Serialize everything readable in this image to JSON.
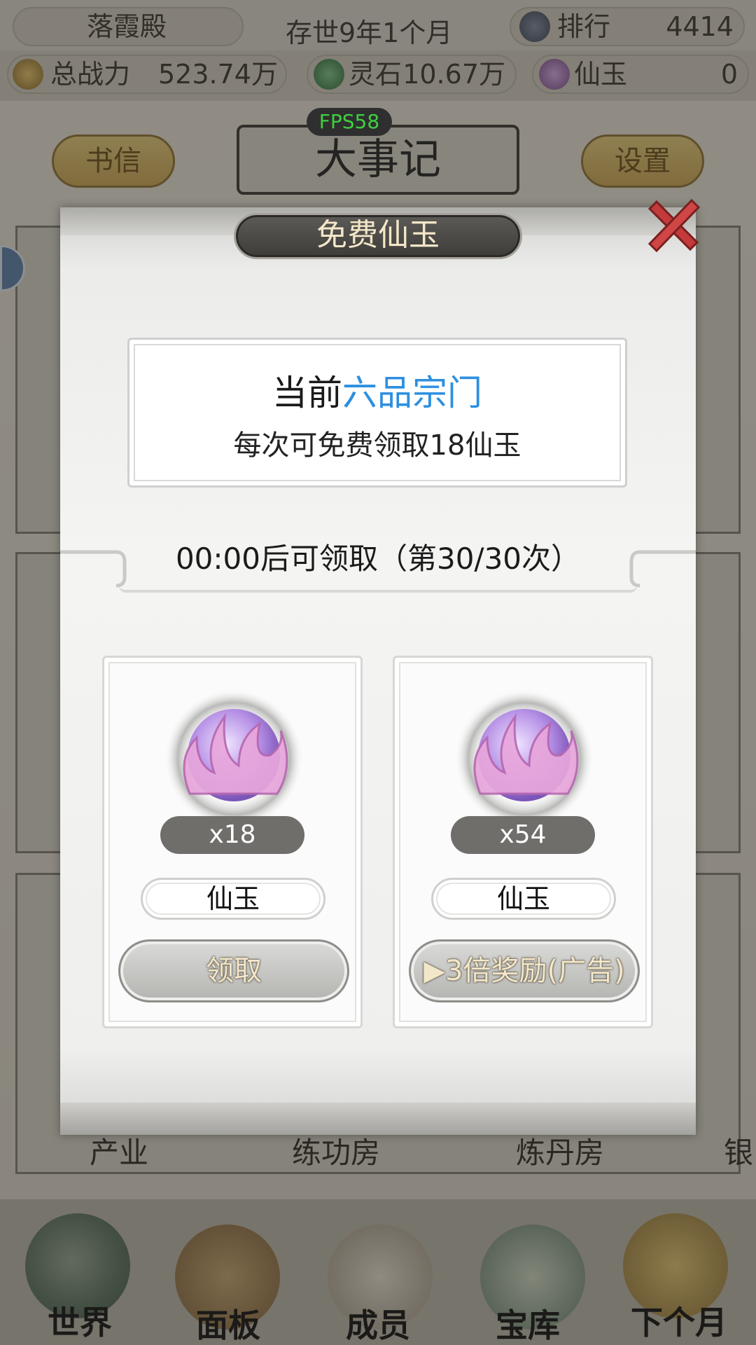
{
  "header": {
    "location": "落霞殿",
    "date": "存世9年1个月",
    "rank_label": "排行",
    "rank_value": "4414",
    "power_label": "总战力",
    "power_value": "523.74万",
    "spirit_stone_label": "灵石",
    "spirit_stone_value": "10.67万",
    "jade_label": "仙玉",
    "jade_value": "0"
  },
  "fps": "FPS58",
  "top_buttons": {
    "letters": "书信",
    "chronicle": "大事记",
    "settings": "设置"
  },
  "background_tabs": [
    "产业",
    "练功房",
    "炼丹房",
    "银"
  ],
  "bottom_nav": [
    "世界",
    "面板",
    "成员",
    "宝库",
    "下个月"
  ],
  "modal": {
    "title": "免费仙玉",
    "sect_prefix": "当前",
    "sect_rank": "六品宗门",
    "sect_desc": "每次可免费领取18仙玉",
    "timer": "00:00后可领取（第30/30次）",
    "rewards": [
      {
        "qty": "x18",
        "name": "仙玉",
        "button": "领取"
      },
      {
        "qty": "x54",
        "name": "仙玉",
        "button": "▶3倍奖励(广告)"
      }
    ]
  },
  "colors": {
    "highlight_blue": "#2d8fe0",
    "fps_green": "#3fd03f",
    "close_red": "#c23a3a"
  }
}
